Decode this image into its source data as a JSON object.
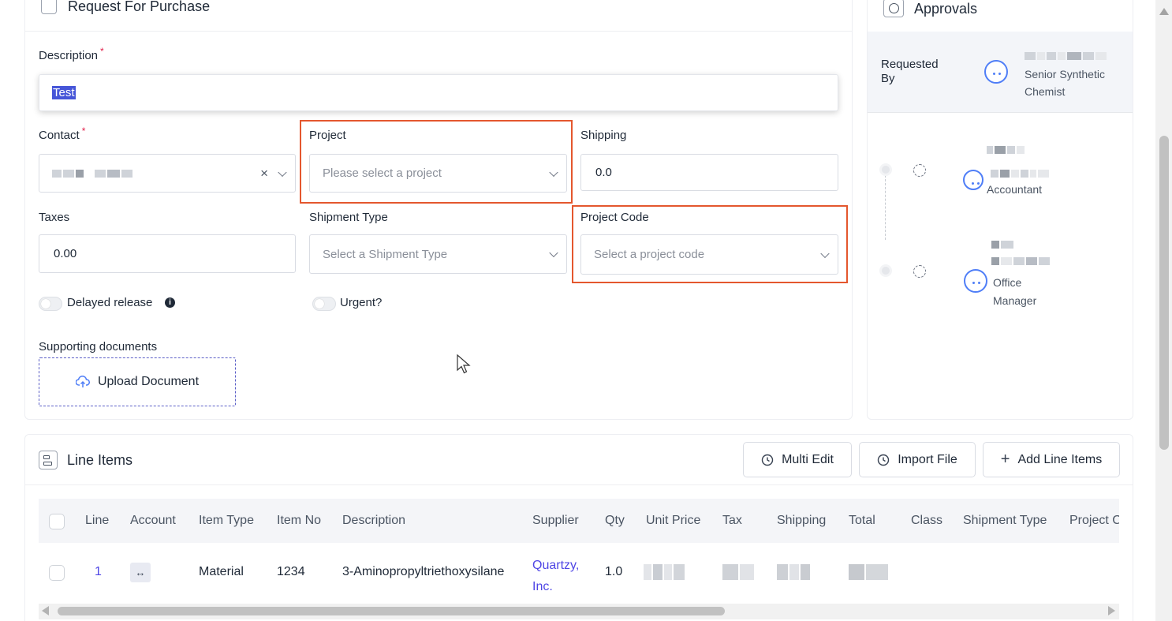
{
  "form": {
    "title": "Request For Purchase",
    "description_label": "Description",
    "description_value": "Test",
    "contact_label": "Contact",
    "project_label": "Project",
    "project_placeholder": "Please select a project",
    "shipping_label": "Shipping",
    "shipping_value": "0.0",
    "taxes_label": "Taxes",
    "taxes_value": "0.00",
    "shipment_type_label": "Shipment Type",
    "shipment_type_placeholder": "Select a Shipment Type",
    "project_code_label": "Project Code",
    "project_code_placeholder": "Select a project code",
    "delayed_release_label": "Delayed release",
    "urgent_label": "Urgent?",
    "supporting_docs_label": "Supporting documents",
    "upload_label": "Upload Document",
    "required_mark": "*",
    "clear_mark": "×"
  },
  "approvals": {
    "title": "Approvals",
    "requested_by_label": "Requested By",
    "requester_role": "Senior Synthetic Chemist",
    "approvers": [
      {
        "role": "Accountant"
      },
      {
        "role": "Office Manager"
      }
    ]
  },
  "line_items": {
    "title": "Line Items",
    "multi_edit_label": "Multi Edit",
    "import_file_label": "Import File",
    "add_line_items_label": "Add Line Items",
    "add_prefix": "+",
    "columns": [
      "Line",
      "Account",
      "Item Type",
      "Item No",
      "Description",
      "Supplier",
      "Qty",
      "Unit Price",
      "Tax",
      "Shipping",
      "Total",
      "Class",
      "Shipment Type",
      "Project C"
    ],
    "rows": [
      {
        "line": "1",
        "item_type": "Material",
        "item_no": "1234",
        "description": "3-Aminopropyltriethoxysilane",
        "supplier_line1": "Quartzy,",
        "supplier_line2": "Inc.",
        "qty": "1.0"
      }
    ]
  },
  "colors": {
    "accent": "#4f46e5",
    "highlight": "#e4572e",
    "avatar": "#4f7ef7"
  }
}
